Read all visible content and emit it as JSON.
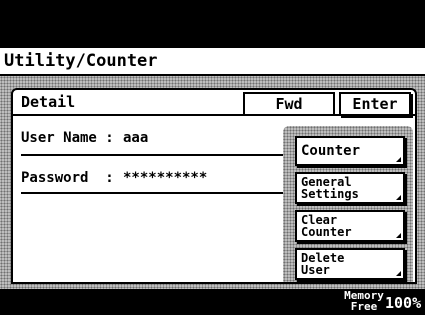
{
  "title": "Utility/Counter",
  "panel": {
    "tab_label": "Detail",
    "fwd_label": "Fwd",
    "enter_label": "Enter"
  },
  "fields": {
    "user_name_label": "User Name :",
    "user_name_value": "aaa",
    "password_label": "Password  :",
    "password_value": "**********"
  },
  "side_buttons": {
    "counter": "Counter",
    "general_line1": "General",
    "general_line2": "Settings",
    "clear_line1": "Clear",
    "clear_line2": "Counter",
    "delete_line1": "Delete",
    "delete_line2": "User"
  },
  "status": {
    "memory_line1": "Memory",
    "memory_line2": "Free",
    "memory_value": "100%"
  }
}
